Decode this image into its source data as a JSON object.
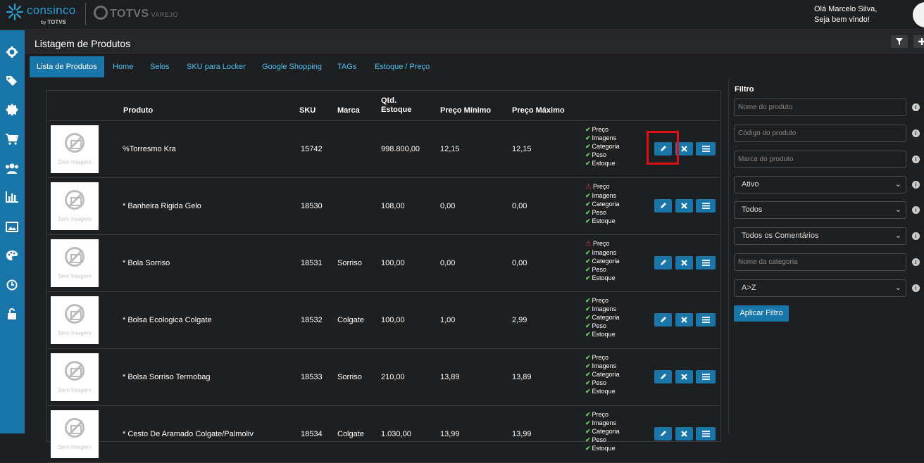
{
  "header": {
    "brand": "consinco",
    "by_text": "by",
    "by_brand": "TOTVS",
    "partner": "TOTVS",
    "partner_sub": "VAREJO",
    "greeting_line1": "Olá Marcelo Silva,",
    "greeting_line2": "Seja bem vindo!"
  },
  "sidebar": {
    "icons": [
      "gear-icon",
      "tags-icon",
      "badge-icon",
      "cart-icon",
      "users-icon",
      "bar-chart-icon",
      "image-icon",
      "palette-icon",
      "clock-icon",
      "unlock-icon"
    ]
  },
  "page": {
    "title": "Listagem de Produtos"
  },
  "tabs": [
    "Lista de Produtos",
    "Home",
    "Selos",
    "SKU para Locker",
    "Google Shopping",
    "TAGs",
    "Estoque / Preço"
  ],
  "table": {
    "headers": {
      "produto": "Produto",
      "sku": "SKU",
      "marca": "Marca",
      "qtd_line1": "Qtd.",
      "qtd_line2": "Estoque",
      "preco_min": "Preço Mínimo",
      "preco_max": "Preço Máximo"
    },
    "placeholder_image_text": "Sem Imagem",
    "check_labels": [
      "Preço",
      "Imagens",
      "Categoria",
      "Peso",
      "Estoque"
    ],
    "rows": [
      {
        "produto": "%Torresmo Kra",
        "sku": "15742",
        "marca": "",
        "qtd": "998.800,00",
        "min": "12,15",
        "max": "12,15",
        "warn_preco": false
      },
      {
        "produto": "* Banheira Rigida Gelo",
        "sku": "18530",
        "marca": "",
        "qtd": "108,00",
        "min": "0,00",
        "max": "0,00",
        "warn_preco": true
      },
      {
        "produto": "* Bola Sorriso",
        "sku": "18531",
        "marca": "Sorriso",
        "qtd": "100,00",
        "min": "0,00",
        "max": "0,00",
        "warn_preco": true
      },
      {
        "produto": "* Bolsa Ecologica Colgate",
        "sku": "18532",
        "marca": "Colgate",
        "qtd": "100,00",
        "min": "1,00",
        "max": "2,99",
        "warn_preco": false
      },
      {
        "produto": "* Bolsa Sorriso Termobag",
        "sku": "18533",
        "marca": "Sorriso",
        "qtd": "210,00",
        "min": "13,89",
        "max": "13,89",
        "warn_preco": false
      },
      {
        "produto": "* Cesto De Aramado Colgate/Palmoliv",
        "sku": "18534",
        "marca": "Colgate",
        "qtd": "1.030,00",
        "min": "13,99",
        "max": "13,99",
        "warn_preco": false
      }
    ]
  },
  "filter": {
    "title": "Filtro",
    "nome_placeholder": "Nome do produto",
    "codigo_placeholder": "Código do produto",
    "marca_placeholder": "Marca do produto",
    "status_value": "Ativo",
    "todos_value": "Todos",
    "comentarios_value": "Todos os Comentários",
    "categoria_placeholder": "Nome da categoria",
    "ordem_value": "A>Z",
    "apply_label": "Aplicar Filtro"
  },
  "colors": {
    "accent": "#1a76a8",
    "link": "#4ec0ef",
    "ok": "#5cd65c",
    "warn": "#e53935",
    "highlight": "#e0101a"
  }
}
